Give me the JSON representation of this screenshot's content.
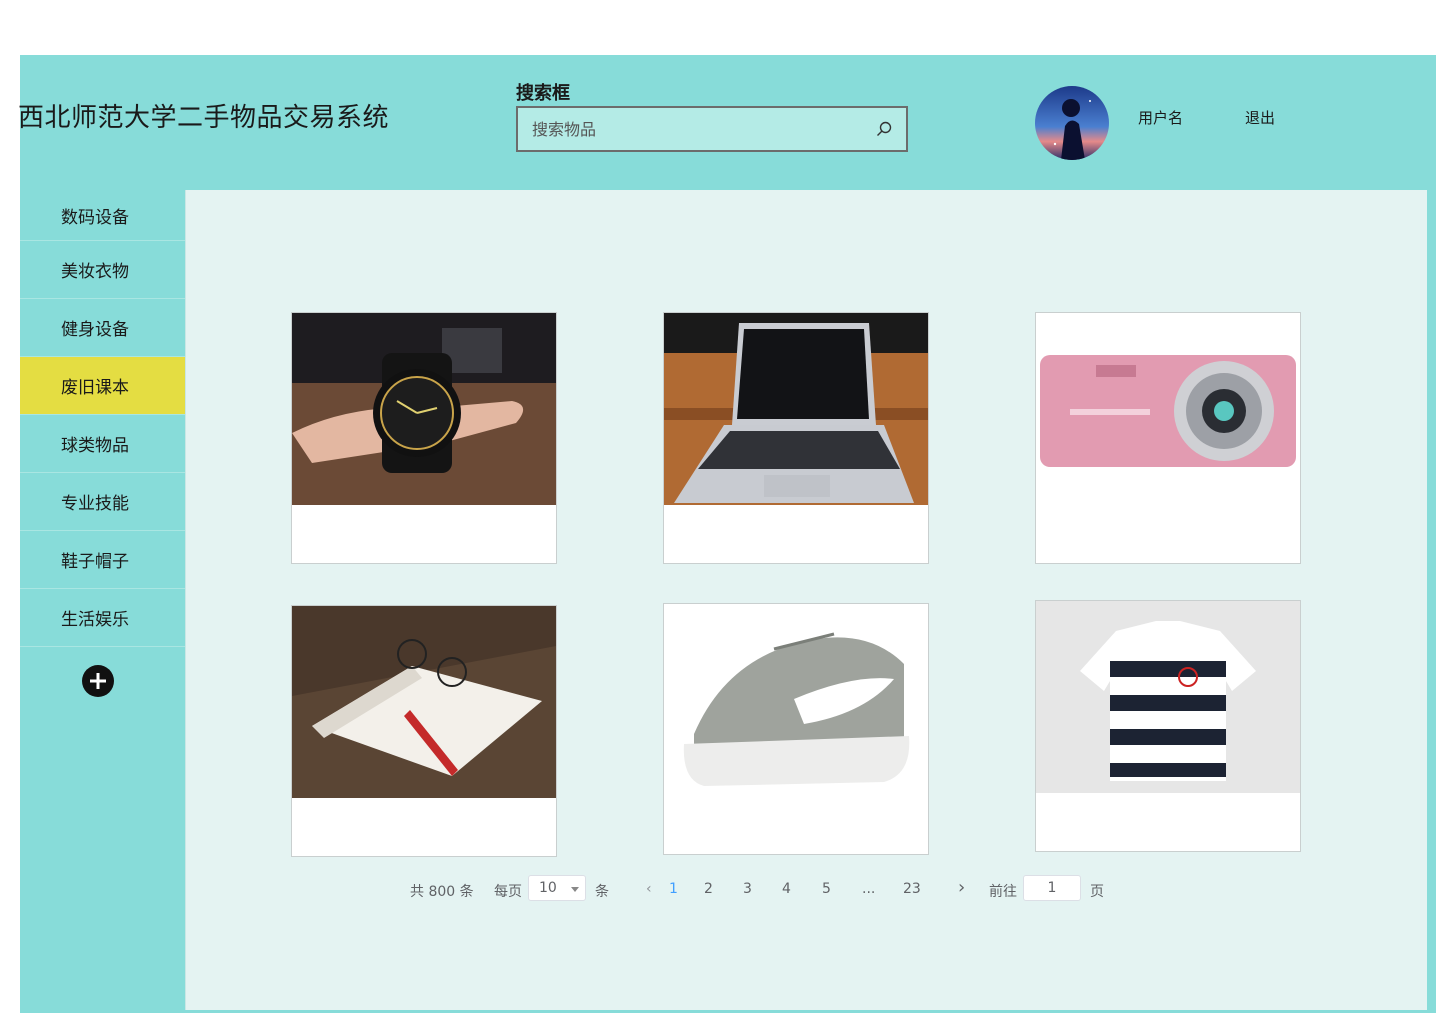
{
  "header": {
    "title": "西北师范大学二手物品交易系统",
    "search_label": "搜索框",
    "search_placeholder": "搜索物品",
    "username": "用户名",
    "logout": "退出"
  },
  "sidebar": {
    "items": [
      {
        "label": "数码设备"
      },
      {
        "label": "美妆衣物"
      },
      {
        "label": "健身设备"
      },
      {
        "label": "废旧课本",
        "active": true
      },
      {
        "label": "球类物品"
      },
      {
        "label": "专业技能"
      },
      {
        "label": "鞋子帽子"
      },
      {
        "label": "生活娱乐"
      }
    ],
    "add_icon": "plus-circle-icon"
  },
  "products": [
    {
      "image": "watch-photo"
    },
    {
      "image": "laptop-photo"
    },
    {
      "image": "camera-photo"
    },
    {
      "image": "book-photo"
    },
    {
      "image": "sneaker-photo"
    },
    {
      "image": "polo-shirt-photo"
    }
  ],
  "pagination": {
    "total": "共 800 条",
    "per_page_label": "每页",
    "per_page_value": "10",
    "per_page_unit": "条",
    "pages": [
      "1",
      "2",
      "3",
      "4",
      "5",
      "...",
      "23"
    ],
    "current_page": "1",
    "goto_label": "前往",
    "goto_value": "1",
    "goto_unit": "页"
  },
  "colors": {
    "background": "#87dcd9",
    "content": "#e4f3f2",
    "active_nav": "#e4dd42",
    "page_active": "#409eff"
  }
}
